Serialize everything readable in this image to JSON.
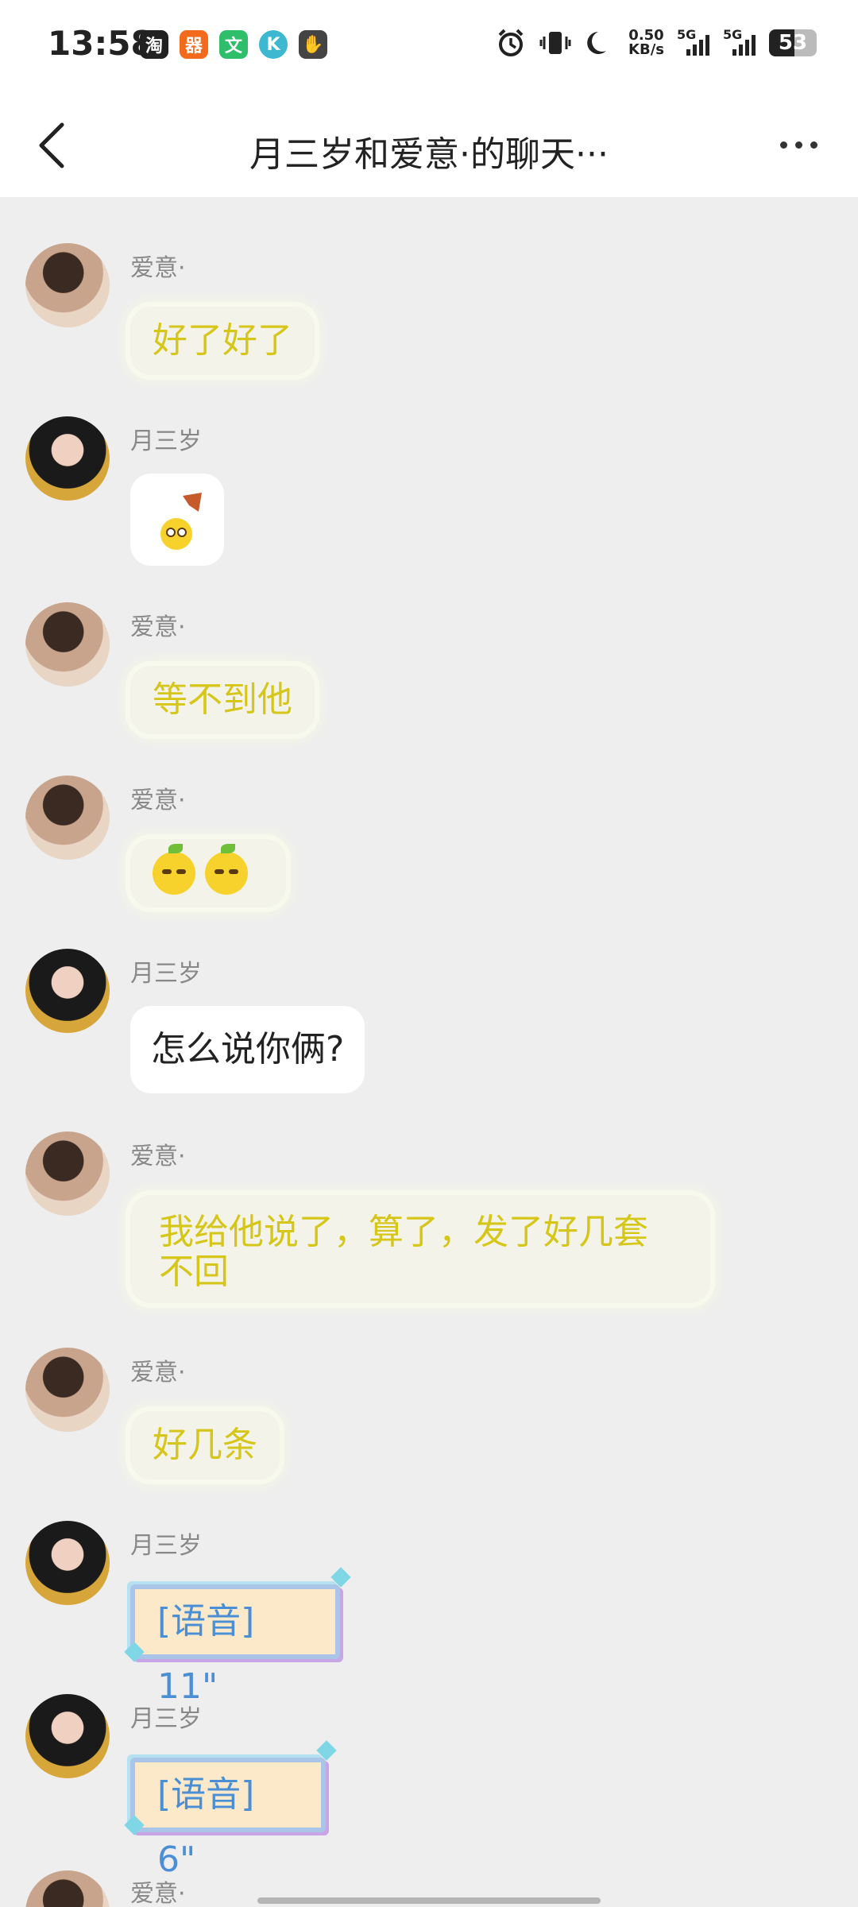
{
  "status_bar": {
    "time": "13:58",
    "app_icons": [
      {
        "name": "taobao-icon",
        "glyph": "淘",
        "color": "#222222"
      },
      {
        "name": "kuaishou-icon",
        "glyph": "器",
        "color": "#f26a1b"
      },
      {
        "name": "translate-icon",
        "glyph": "文",
        "color": "#ffffff"
      },
      {
        "name": "k-app-icon",
        "glyph": "K",
        "color": "#ffffff"
      },
      {
        "name": "handshake-icon",
        "glyph": "✋",
        "color": "#ffffff"
      }
    ],
    "net_speed_value": "0.50",
    "net_speed_unit": "KB/s",
    "signal_labels": [
      "5G",
      "5G"
    ],
    "battery": "53"
  },
  "header": {
    "title": "月三岁和爱意·的聊天···"
  },
  "messages": [
    {
      "sender": "爱意·",
      "text": "好了好了"
    },
    {
      "sender": "月三岁",
      "text": ""
    },
    {
      "sender": "爱意·",
      "text": "等不到他"
    },
    {
      "sender": "爱意·",
      "text": ""
    },
    {
      "sender": "月三岁",
      "text": "怎么说你俩?"
    },
    {
      "sender": "爱意·",
      "text_line1": "我给他说了，算了，发了好几套",
      "text_line2": "不回"
    },
    {
      "sender": "爱意·",
      "text": "好几条"
    },
    {
      "sender": "月三岁",
      "text": "[语音] 11\""
    },
    {
      "sender": "月三岁",
      "text": "[语音] 6\""
    },
    {
      "sender": "爱意·",
      "text": ""
    }
  ]
}
